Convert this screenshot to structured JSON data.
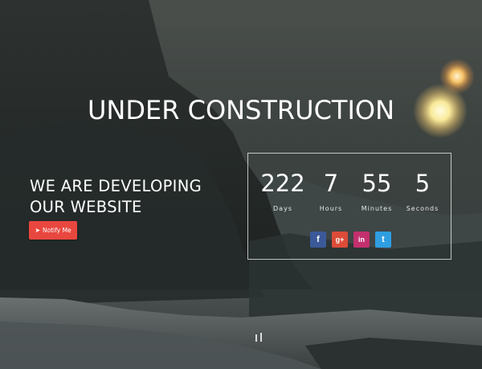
{
  "page": {
    "title": "UNDER CONSTRUCTION",
    "tagline_line1": "WE ARE DEVELOPING",
    "tagline_line2": "OUR WEBSITE",
    "notify_label": "Notify Me",
    "notify_icon": "paper-plane-icon"
  },
  "countdown": {
    "units": [
      {
        "value": "222",
        "label": "Days"
      },
      {
        "value": "7",
        "label": "Hours"
      },
      {
        "value": "55",
        "label": "Minutes"
      },
      {
        "value": "5",
        "label": "Seconds"
      }
    ]
  },
  "social": [
    {
      "name": "facebook-icon",
      "glyph": "f",
      "color": "#3b5998"
    },
    {
      "name": "google-plus-icon",
      "glyph": "g+",
      "color": "#dd4b39"
    },
    {
      "name": "linkedin-icon",
      "glyph": "in",
      "color": "#c2306e"
    },
    {
      "name": "twitter-icon",
      "glyph": "t",
      "color": "#2f9ee0"
    }
  ],
  "colors": {
    "accent": "#e8473f",
    "sky": "#4a4f4c",
    "sun": "#f6e7a4"
  }
}
